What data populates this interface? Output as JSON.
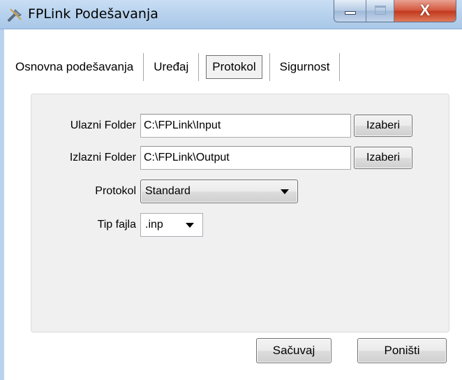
{
  "window": {
    "title": "FPLink Podešavanja",
    "icon": "wrench-screwdriver-icon",
    "close_glyph": "X"
  },
  "tabs": [
    {
      "label": "Osnovna podešavanja",
      "active": false
    },
    {
      "label": "Uređaj",
      "active": false
    },
    {
      "label": "Protokol",
      "active": true
    },
    {
      "label": "Sigurnost",
      "active": false
    }
  ],
  "form": {
    "input_folder": {
      "label": "Ulazni Folder",
      "value": "C:\\FPLink\\Input",
      "browse_label": "Izaberi"
    },
    "output_folder": {
      "label": "Izlazni Folder",
      "value": "C:\\FPLink\\Output",
      "browse_label": "Izaberi"
    },
    "protocol": {
      "label": "Protokol",
      "selected": "Standard"
    },
    "file_type": {
      "label": "Tip fajla",
      "selected": ".inp"
    }
  },
  "buttons": {
    "save": "Sačuvaj",
    "cancel": "Poništi"
  }
}
